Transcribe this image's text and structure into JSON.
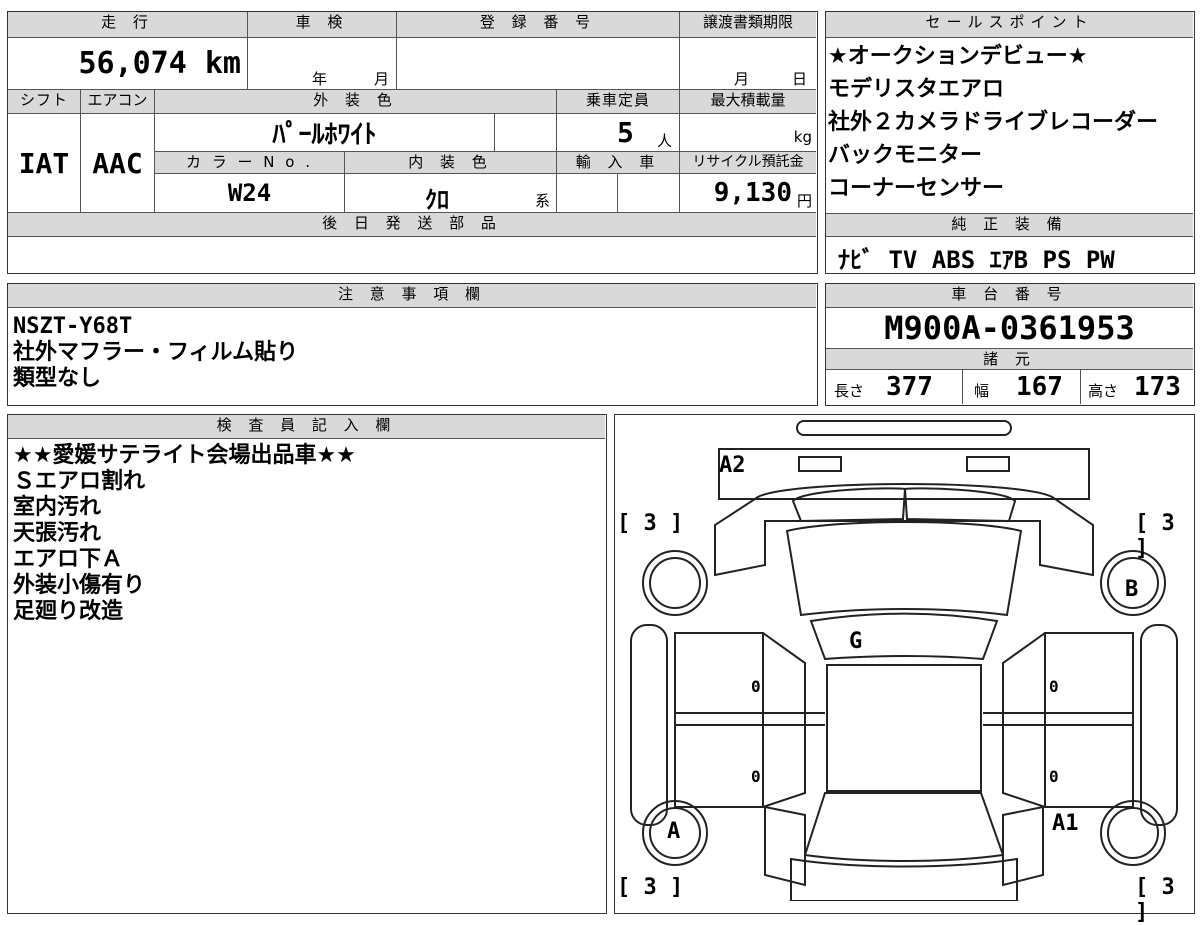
{
  "top_table": {
    "headers": {
      "mileage": "走 行",
      "inspection": "車 検",
      "registration": "登 録 番 号",
      "transfer_deadline": "譲渡書類期限",
      "shift": "シフト",
      "aircon": "エアコン",
      "exterior_color": "外 装 色",
      "capacity": "乗車定員",
      "max_load": "最大積載量",
      "color_no": "カ ラ ー N o .",
      "interior_color": "内 装 色",
      "import": "輸 入 車",
      "recycle": "リサイクル預託金",
      "later_parts": "後 日 発 送 部 品"
    },
    "mileage_value": "56,074 km",
    "inspection_year": "年",
    "inspection_month": "月",
    "transfer_month": "月",
    "transfer_day": "日",
    "shift_value": "IAT",
    "aircon_value": "AAC",
    "exterior_color_value": "ﾊﾟｰﾙﾎﾜｲﾄ",
    "capacity_value": "5",
    "capacity_unit": "人",
    "max_load_unit": "kg",
    "color_no_value": "W24",
    "interior_color_value": "ｸﾛ",
    "interior_color_suffix": "系",
    "recycle_value": "9,130",
    "recycle_unit": "円"
  },
  "sales_points": {
    "header": "セールスポイント",
    "items": [
      "★オークションデビュー★",
      "モデリスタエアロ",
      "社外２カメラドライブレコーダー",
      "バックモニター",
      "コーナーセンサー"
    ]
  },
  "genuine_equipment": {
    "header": "純 正 装 備",
    "value": "ﾅﾋﾞ TV ABS ｴｱB PS PW"
  },
  "notes": {
    "header": "注 意 事 項 欄",
    "lines": [
      "NSZT-Y68T",
      "社外マフラー・フィルム貼り",
      "類型なし"
    ]
  },
  "chassis": {
    "header": "車 台 番 号",
    "value": "M900A-0361953"
  },
  "specs": {
    "header": "諸 元",
    "length_label": "長さ",
    "length_value": "377",
    "width_label": "幅",
    "width_value": "167",
    "height_label": "高さ",
    "height_value": "173"
  },
  "inspector": {
    "header": "検 査 員 記 入 欄",
    "lines": [
      "★★愛媛サテライト会場出品車★★",
      "Ｓエアロ割れ",
      "室内汚れ",
      "天張汚れ",
      "エアロ下Ａ",
      "外装小傷有り",
      "足廻り改造"
    ]
  },
  "diagram": {
    "labels": {
      "a2": "A2",
      "g": "G",
      "b": "B",
      "a": "A",
      "a1": "A1",
      "tire_tl": "[ 3 ]",
      "tire_tr": "[ 3 ]",
      "tire_bl": "[ 3 ]",
      "tire_br": "[ 3 ]",
      "zero_l1": "0",
      "zero_l2": "0",
      "zero_r1": "0",
      "zero_r2": "0"
    }
  }
}
